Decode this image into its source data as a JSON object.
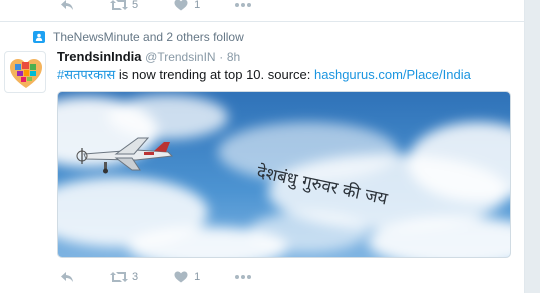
{
  "top_actions": {
    "reply_icon": "reply-icon",
    "retweet_icon": "retweet-icon",
    "retweet_count": "5",
    "like_icon": "heart-icon",
    "like_count": "1",
    "more_icon": "more-icon"
  },
  "social_context": {
    "icon": "follow-icon",
    "text": "TheNewsMinute and 2 others follow"
  },
  "tweet": {
    "display_name": "TrendsinIndia",
    "handle": "@TrendsinIN",
    "separator": "·",
    "time": "8h",
    "hashtag": "#सतपरकास",
    "body_middle": " is now trending at top 10. source: ",
    "link": "hashgurus.com/Place/India",
    "banner_text": "देशबंधु गुरुवर की जय"
  },
  "bottom_actions": {
    "reply_icon": "reply-icon",
    "retweet_icon": "retweet-icon",
    "retweet_count": "3",
    "like_icon": "heart-icon",
    "like_count": "1",
    "more_icon": "more-icon"
  },
  "colors": {
    "link": "#1b95e0",
    "muted": "#8899a6",
    "icon": "#aab8c2",
    "sky": "#3d82c4"
  }
}
